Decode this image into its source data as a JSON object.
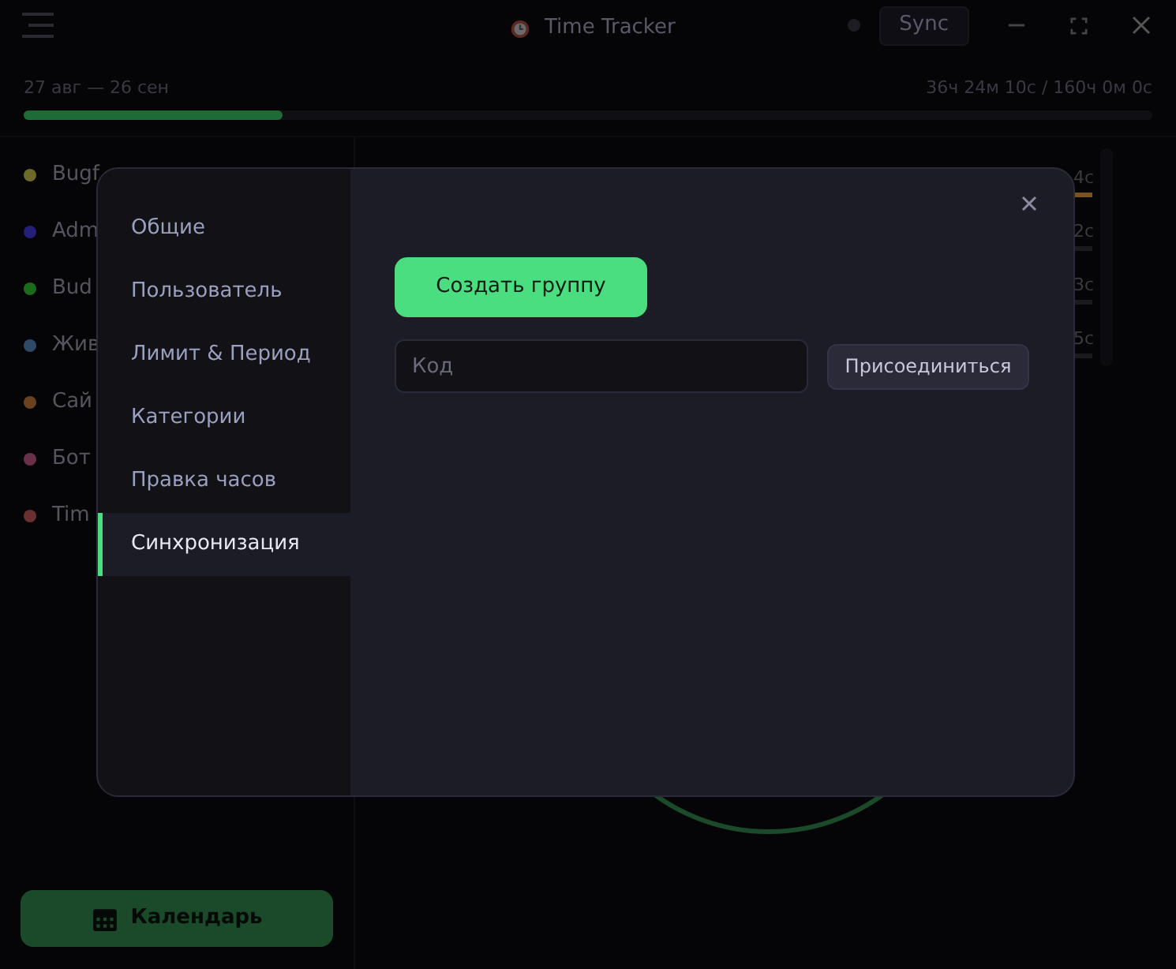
{
  "window": {
    "title": "Time Tracker",
    "sync_button": "Sync"
  },
  "period": {
    "range": "27 авг — 26 сен",
    "total": "36ч 24м 10с / 160ч 0м 0с",
    "level": 0.23
  },
  "categories": [
    {
      "label": "Bugf",
      "color": "#6b6a2a"
    },
    {
      "label": "Adm",
      "color": "#24207a"
    },
    {
      "label": "Bud",
      "color": "#1c6a1c"
    },
    {
      "label": "Жив",
      "color": "#2f4a66"
    },
    {
      "label": "Сай",
      "color": "#6a4220"
    },
    {
      "label": "Бот",
      "color": "#6a2f4a"
    },
    {
      "label": "Tim",
      "color": "#6a2f2f"
    }
  ],
  "calendar_button": "Календарь",
  "durations": [
    {
      "text": "4с",
      "color": "#7a5220"
    },
    {
      "text": "2с",
      "color": "#1a1a1f"
    },
    {
      "text": "3с",
      "color": "#1a1a1f"
    },
    {
      "text": "5с",
      "color": "#1a1a1f"
    }
  ],
  "settings": {
    "nav": [
      {
        "label": "Общие",
        "selected": false
      },
      {
        "label": "Пользователь",
        "selected": false
      },
      {
        "label": "Лимит & Период",
        "selected": false
      },
      {
        "label": "Категории",
        "selected": false
      },
      {
        "label": "Правка часов",
        "selected": false
      },
      {
        "label": "Синхронизация",
        "selected": true
      }
    ],
    "create_button": "Создать группу",
    "code_field": {
      "placeholder": "Код"
    },
    "join_button": "Присоединиться"
  }
}
